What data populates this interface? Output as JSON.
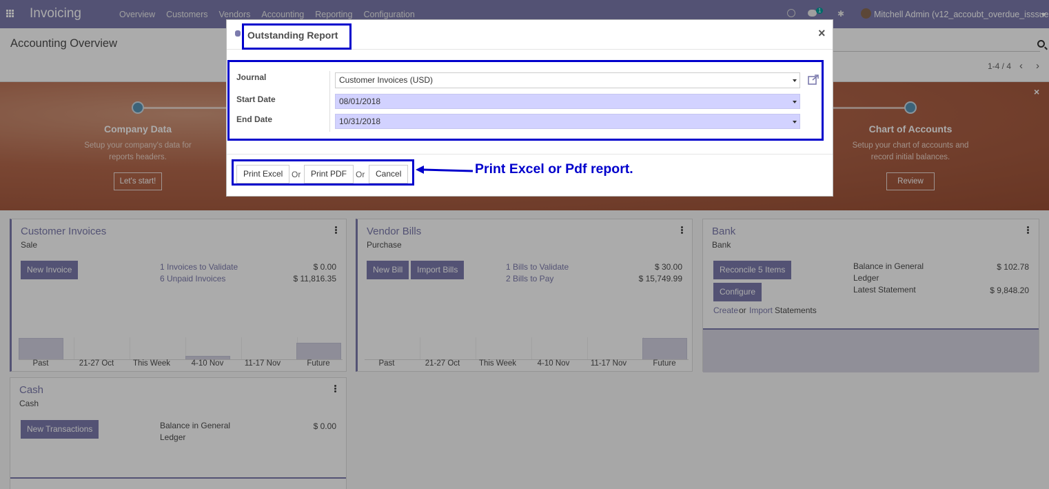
{
  "navbar": {
    "app_title": "Invoicing",
    "menu": [
      "Overview",
      "Customers",
      "Vendors",
      "Accounting",
      "Reporting",
      "Configuration"
    ],
    "chat_count": "1",
    "user_name": "Mitchell Admin (v12_accoubt_overdue_isssue)"
  },
  "control_panel": {
    "breadcrumb": "Accounting Overview",
    "pager": "1-4 / 4",
    "pager_prev": "‹",
    "pager_next": "›"
  },
  "banner": {
    "close": "×",
    "steps": [
      {
        "title": "Company Data",
        "description": "Setup your company's data for reports headers.",
        "button": "Let's start!"
      },
      {
        "title": "Chart of Accounts",
        "description": "Setup your chart of accounts and record initial balances.",
        "button": "Review"
      }
    ]
  },
  "dashboard": {
    "customer_invoices": {
      "title": "Customer Invoices",
      "subtitle": "Sale",
      "button": "New Invoice",
      "stats": [
        {
          "label": "1 Invoices to Validate",
          "amount": "$ 0.00"
        },
        {
          "label": "6 Unpaid Invoices",
          "amount": "$ 11,816.35"
        }
      ],
      "graph_labels": [
        "Past",
        "21-27 Oct",
        "This Week",
        "4-10 Nov",
        "11-17 Nov",
        "Future"
      ]
    },
    "vendor_bills": {
      "title": "Vendor Bills",
      "subtitle": "Purchase",
      "buttons": [
        "New Bill",
        "Import Bills"
      ],
      "stats": [
        {
          "label": "1 Bills to Validate",
          "amount": "$ 30.00"
        },
        {
          "label": "2 Bills to Pay",
          "amount": "$ 15,749.99"
        }
      ],
      "graph_labels": [
        "Past",
        "21-27 Oct",
        "This Week",
        "4-10 Nov",
        "11-17 Nov",
        "Future"
      ]
    },
    "bank": {
      "title": "Bank",
      "subtitle": "Bank",
      "reconcile_button": "Reconcile 5 Items",
      "configure_button": "Configure",
      "create_link": "Create",
      "or_text": "or",
      "import_link": "Import",
      "statements_text": "Statements",
      "stats": [
        {
          "label": "Balance in General Ledger",
          "amount": "$ 102.78"
        },
        {
          "label": "Latest Statement",
          "amount": "$ 9,848.20"
        }
      ]
    },
    "cash": {
      "title": "Cash",
      "subtitle": "Cash",
      "button": "New Transactions",
      "stats": [
        {
          "label": "Balance in General Ledger",
          "amount": "$ 0.00"
        }
      ]
    }
  },
  "modal": {
    "title": "Outstanding Report",
    "close": "×",
    "fields": {
      "journal": {
        "label": "Journal",
        "value": "Customer Invoices (USD)"
      },
      "start_date": {
        "label": "Start Date",
        "value": "08/01/2018"
      },
      "end_date": {
        "label": "End Date",
        "value": "10/31/2018"
      }
    },
    "footer": {
      "print_excel": "Print Excel",
      "or_1": "Or",
      "print_pdf": "Print PDF",
      "or_2": "Or",
      "cancel": "Cancel"
    }
  },
  "annotation": {
    "text": "Print Excel or Pdf report.",
    "color": "#0000cc"
  },
  "colors": {
    "navbar": "#7c7bad",
    "primary": "#7c7bad",
    "date_field": "#d2d2ff"
  }
}
